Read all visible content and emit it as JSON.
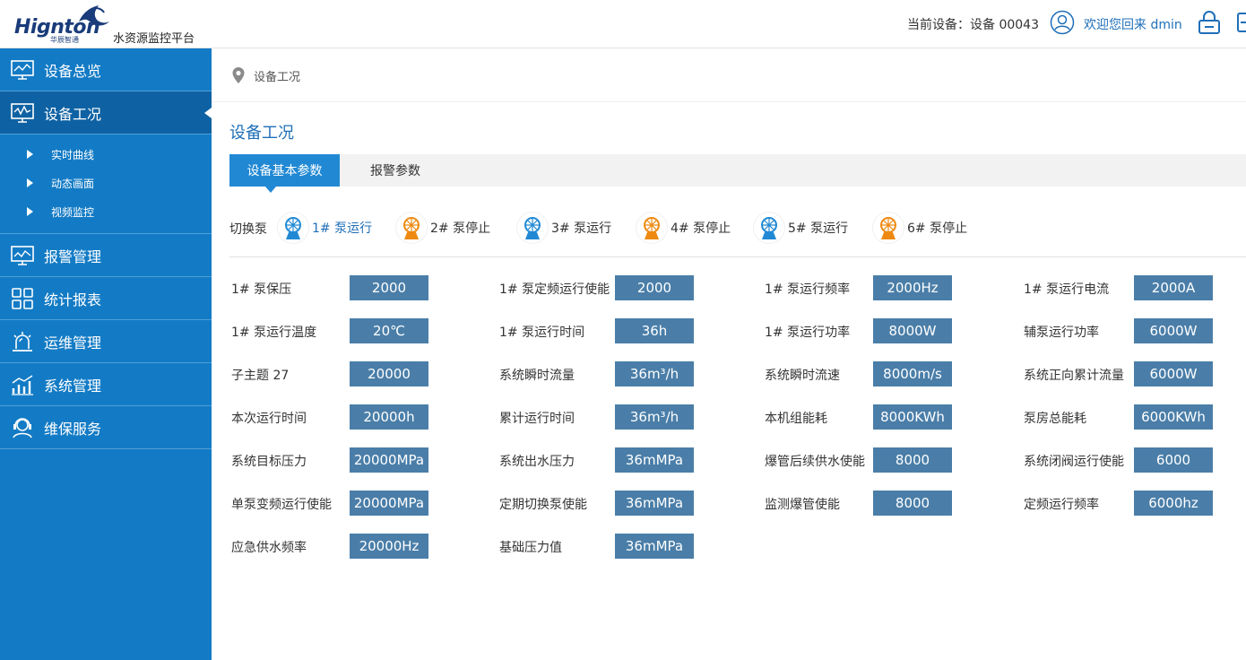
{
  "header": {
    "logo_text": "Hignton",
    "logo_sub": "华辰智通",
    "platform_name": "水资源监控平台",
    "current_device": "当前设备：设备 00043",
    "welcome": "欢迎您回来 dmin"
  },
  "sidebar": {
    "items": [
      {
        "label": "设备总览",
        "icon": "monitor-icon"
      },
      {
        "label": "设备工况",
        "icon": "monitor-chart-icon"
      },
      {
        "label": "报警管理",
        "icon": "alarm-monitor-icon"
      },
      {
        "label": "统计报表",
        "icon": "grid-icon"
      },
      {
        "label": "运维管理",
        "icon": "beacon-icon"
      },
      {
        "label": "系统管理",
        "icon": "bar-chart-icon"
      },
      {
        "label": "维保服务",
        "icon": "support-icon"
      }
    ],
    "sub_items": [
      {
        "label": "实时曲线"
      },
      {
        "label": "动态画面"
      },
      {
        "label": "视频监控"
      }
    ]
  },
  "breadcrumb": {
    "text": "设备工况"
  },
  "page": {
    "title": "设备工况"
  },
  "tabs": [
    {
      "label": "设备基本参数"
    },
    {
      "label": "报警参数"
    }
  ],
  "pumps": {
    "label": "切换泵",
    "items": [
      {
        "label": "1# 泵运行",
        "status": "running"
      },
      {
        "label": "2# 泵停止",
        "status": "stopped"
      },
      {
        "label": "3# 泵运行",
        "status": "running"
      },
      {
        "label": "4# 泵停止",
        "status": "stopped"
      },
      {
        "label": "5# 泵运行",
        "status": "running"
      },
      {
        "label": "6# 泵停止",
        "status": "stopped"
      }
    ]
  },
  "params": {
    "rows": [
      [
        {
          "label": "1# 泵保压",
          "value": "2000"
        },
        {
          "label": "1# 泵定频运行使能",
          "value": "2000"
        },
        {
          "label": "1# 泵运行频率",
          "value": "2000Hz"
        },
        {
          "label": "1# 泵运行电流",
          "value": "2000A"
        }
      ],
      [
        {
          "label": "1# 泵运行温度",
          "value": "20℃"
        },
        {
          "label": "1# 泵运行时间",
          "value": "36h"
        },
        {
          "label": "1# 泵运行功率",
          "value": "8000W"
        },
        {
          "label": "辅泵运行功率",
          "value": "6000W"
        }
      ],
      [
        {
          "label": "子主题 27",
          "value": "20000"
        },
        {
          "label": "系统瞬时流量",
          "value": "36m³/h"
        },
        {
          "label": "系统瞬时流速",
          "value": "8000m/s"
        },
        {
          "label": "系统正向累计流量",
          "value": "6000W"
        }
      ],
      [
        {
          "label": "本次运行时间",
          "value": "20000h"
        },
        {
          "label": "累计运行时间",
          "value": "36m³/h"
        },
        {
          "label": "本机组能耗",
          "value": "8000KWh"
        },
        {
          "label": "泵房总能耗",
          "value": "6000KWh"
        }
      ],
      [
        {
          "label": "系统目标压力",
          "value": "20000MPa"
        },
        {
          "label": "系统出水压力",
          "value": "36mMPa"
        },
        {
          "label": "爆管后续供水使能",
          "value": "8000"
        },
        {
          "label": "系统闭阀运行使能",
          "value": "6000"
        }
      ],
      [
        {
          "label": "单泵变频运行使能",
          "value": "20000MPa"
        },
        {
          "label": "定期切换泵使能",
          "value": "36mMPa"
        },
        {
          "label": "监测爆管使能",
          "value": "8000"
        },
        {
          "label": "定频运行频率",
          "value": "6000hz"
        }
      ],
      [
        {
          "label": "应急供水频率",
          "value": "20000Hz"
        },
        {
          "label": "基础压力值",
          "value": "36mMPa"
        }
      ]
    ]
  },
  "colors": {
    "sidebar": "#137bc5",
    "sidebar_active": "#0e62a3",
    "accent": "#1f6fb8",
    "value_box": "#4a7ea8",
    "pump_running": "#2189d4",
    "pump_stopped": "#ee8a12"
  }
}
